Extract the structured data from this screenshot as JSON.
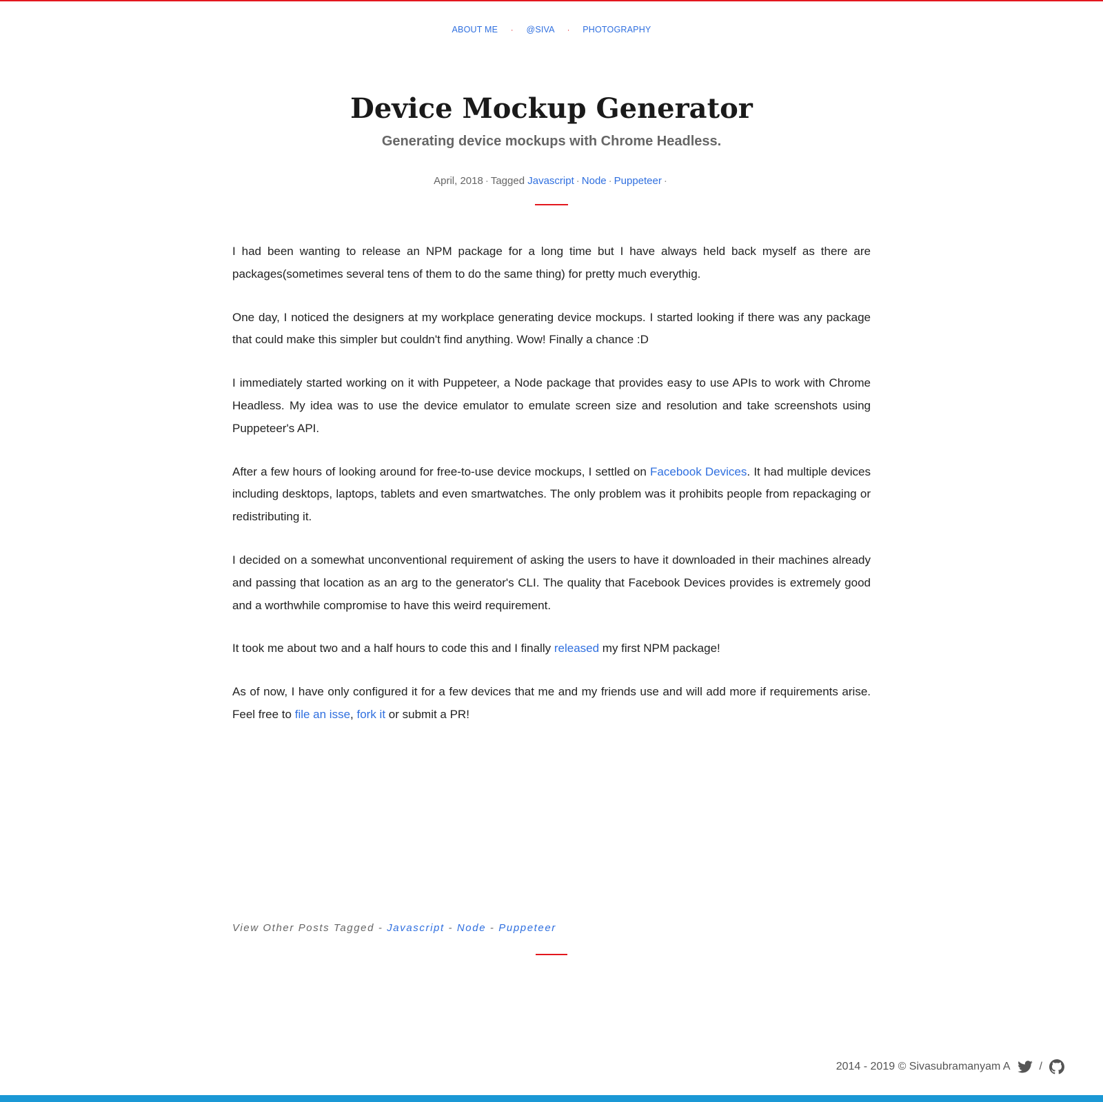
{
  "nav": {
    "items": [
      {
        "label": "ABOUT ME"
      },
      {
        "label": "@SIVA"
      },
      {
        "label": "PHOTOGRAPHY"
      }
    ],
    "separator": "·"
  },
  "post": {
    "title": "Device Mockup Generator",
    "subtitle": "Generating device mockups with Chrome Headless.",
    "date": "April, 2018",
    "tagged_label": "Tagged",
    "tags": [
      "Javascript",
      "Node",
      "Puppeteer"
    ],
    "separator": "·"
  },
  "article": {
    "p1": "I had been wanting to release an NPM package for a long time but I have always held back myself as there are packages(sometimes several tens of them to do the same thing) for pretty much everythig.",
    "p2": "One day, I noticed the designers at my workplace generating device mockups. I started looking if there was any package that could make this simpler but couldn't find anything. Wow! Finally a chance :D",
    "p3": "I immediately started working on it with Puppeteer, a Node package that provides easy to use APIs to work with Chrome Headless. My idea was to use the device emulator to emulate screen size and resolution and take screenshots using Puppeteer's API.",
    "p4": {
      "before": "After a few hours of looking around for free-to-use device mockups, I settled on ",
      "link": "Facebook Devices",
      "after": ". It had multiple devices including desktops, laptops, tablets and even smartwatches. The only problem was it prohibits people from repackaging or redistributing it."
    },
    "p5": "I decided on a somewhat unconventional requirement of asking the users to have it downloaded in their machines already and passing that location as an arg to the generator's CLI. The quality that Facebook Devices provides is extremely good and a worthwhile compromise to have this weird requirement.",
    "p6": {
      "before": "It took me about two and a half hours to code this and I finally ",
      "link": "released",
      "after": " my first NPM package!"
    },
    "p7": {
      "before": "As of now, I have only configured it for a few devices that me and my friends use and will add more if requirements arise. Feel free to ",
      "link1": "file an isse",
      "mid": ", ",
      "link2": "fork it",
      "after": " or submit a PR!"
    }
  },
  "tagged_footer": {
    "label": "View Other Posts Tagged - ",
    "tags": [
      "Javascript",
      "Node",
      "Puppeteer"
    ],
    "separator": " - "
  },
  "footer": {
    "copyright": "2014 - 2019 © Sivasubramanyam A",
    "slash": "/",
    "icons": [
      "twitter-icon",
      "github-icon"
    ]
  },
  "colors": {
    "accent_red": "#e3171e",
    "link_blue": "#2f6fdf",
    "bottom_bar_blue": "#1a98d5"
  }
}
